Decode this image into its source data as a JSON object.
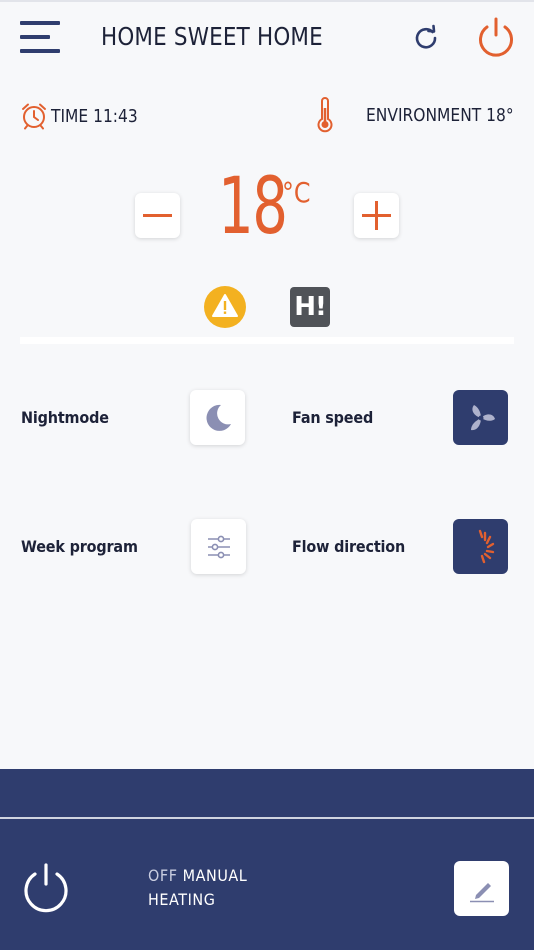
{
  "header": {
    "title": "HOME SWEET HOME",
    "menu_icon": "hamburger-menu-icon",
    "refresh_icon": "refresh-icon",
    "power_icon": "power-icon"
  },
  "info": {
    "time_label": "TIME",
    "time_value": "11:43",
    "environment_label": "ENVIRONMENT",
    "environment_value": "18°"
  },
  "thermostat": {
    "setpoint": "18",
    "unit": "°C"
  },
  "alerts": {
    "warning_icon": "warning-icon",
    "hi_badge": "H!"
  },
  "controls": [
    {
      "label": "Nightmode",
      "icon": "moon-icon"
    },
    {
      "label": "Fan speed",
      "icon": "fan-icon"
    },
    {
      "label": "Week program",
      "icon": "sliders-icon"
    },
    {
      "label": "Flow direction",
      "icon": "airflow-icon"
    }
  ],
  "footer": {
    "status_off": "OFF",
    "status_mode": "MANUAL",
    "status_function": "HEATING",
    "power_icon": "power-icon",
    "edit_icon": "pencil-icon"
  },
  "colors": {
    "accent_orange": "#e2602f",
    "navy": "#2f3d6e",
    "warning_yellow": "#f3b120",
    "background": "#f7f8fa"
  }
}
